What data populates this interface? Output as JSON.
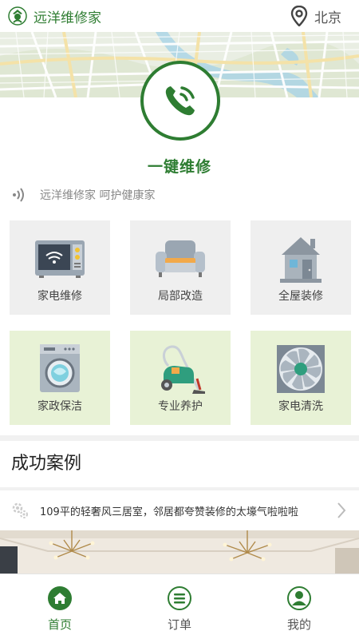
{
  "header": {
    "app_name": "远洋维修家",
    "city": "北京"
  },
  "hero": {
    "action_label": "一键维修"
  },
  "slogan": "远洋维修家  呵护健康家",
  "services": [
    {
      "label": "家电维修",
      "icon": "microwave-icon"
    },
    {
      "label": "局部改造",
      "icon": "armchair-icon"
    },
    {
      "label": "全屋装修",
      "icon": "house-icon"
    },
    {
      "label": "家政保洁",
      "icon": "washing-machine-icon"
    },
    {
      "label": "专业养护",
      "icon": "vacuum-cleaner-icon"
    },
    {
      "label": "家电清洗",
      "icon": "fan-icon"
    }
  ],
  "cases": {
    "title": "成功案例",
    "items": [
      {
        "text": "109平的轻奢风三居室，邻居都夸赞装修的太壕气啦啦啦"
      }
    ]
  },
  "tabs": [
    {
      "label": "首页",
      "icon": "home-icon",
      "active": true
    },
    {
      "label": "订单",
      "icon": "list-icon",
      "active": false
    },
    {
      "label": "我的",
      "icon": "user-icon",
      "active": false
    }
  ],
  "colors": {
    "brand": "#2e7d32",
    "tile_gray": "#efefef",
    "tile_green": "#e8f2d6"
  }
}
